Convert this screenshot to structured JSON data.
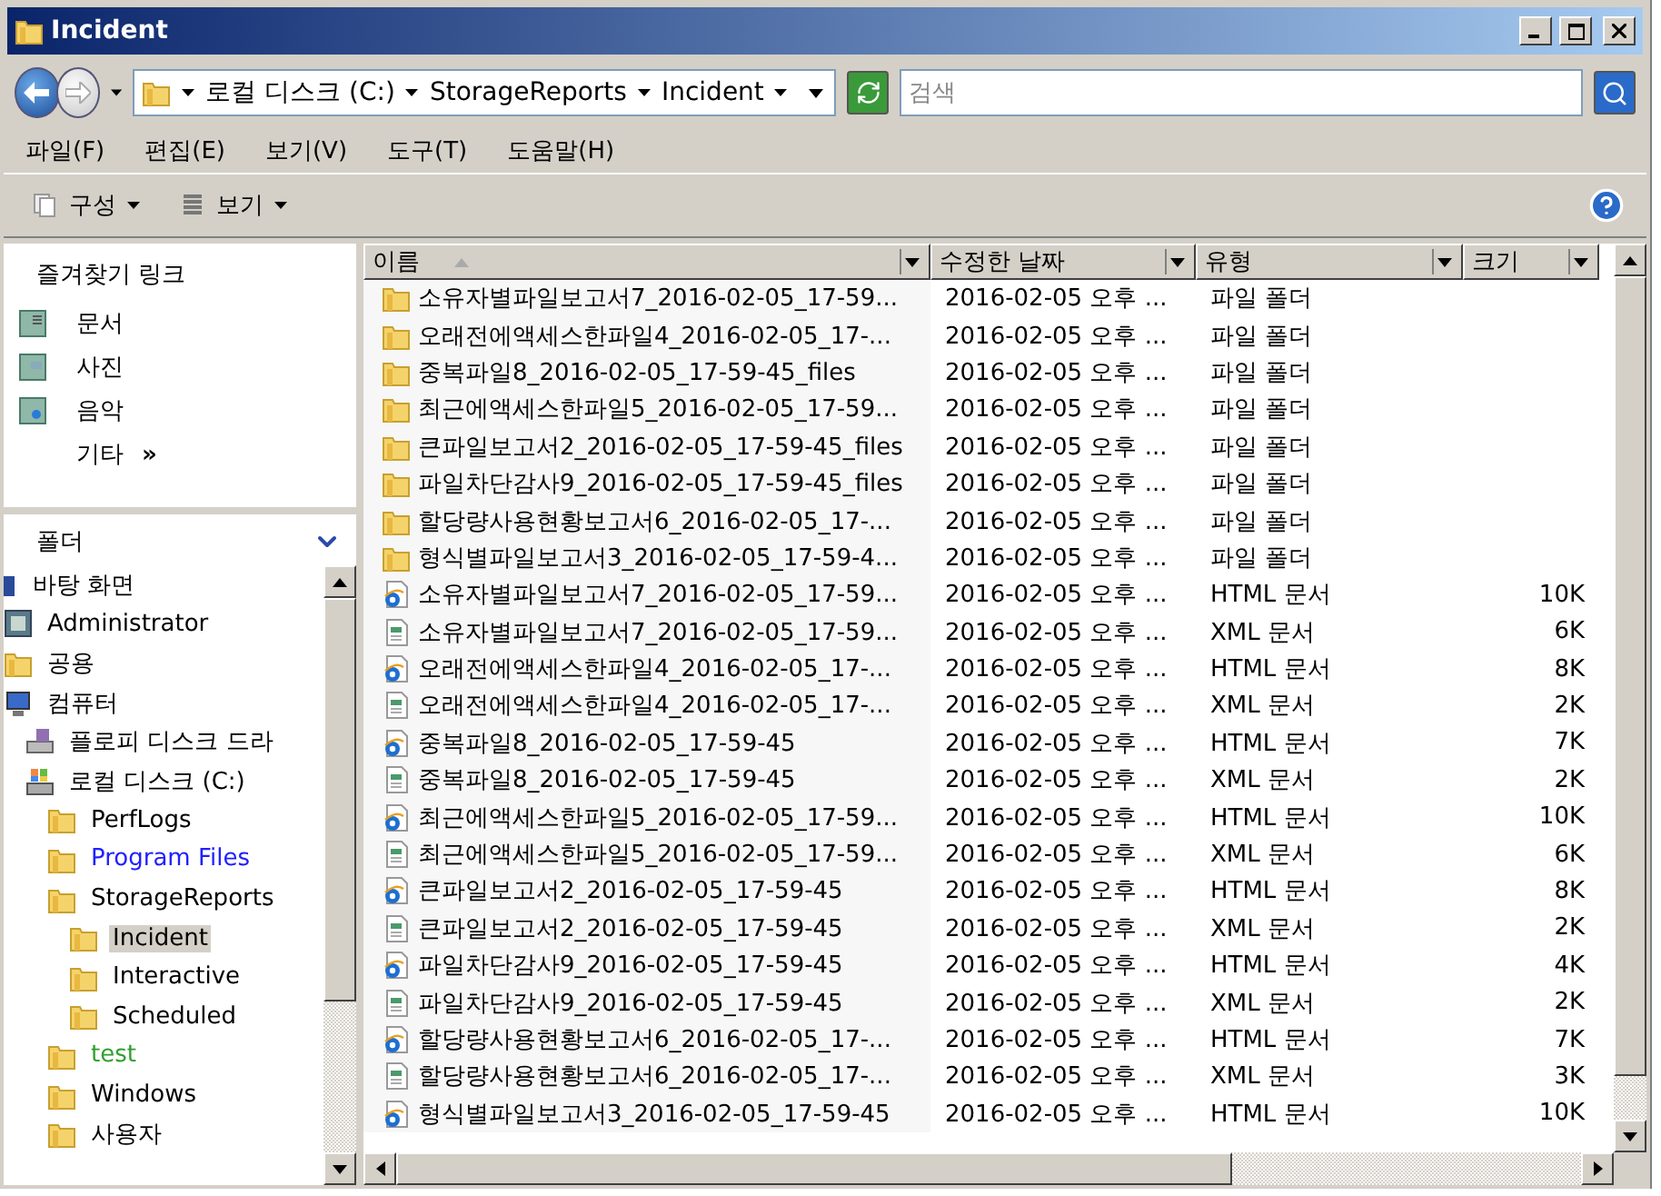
{
  "window": {
    "title": "Incident"
  },
  "address": {
    "crumbs": [
      "로컬 디스크 (C:)",
      "StorageReports",
      "Incident"
    ],
    "search_placeholder": "검색"
  },
  "menu": [
    "파일(F)",
    "편집(E)",
    "보기(V)",
    "도구(T)",
    "도움말(H)"
  ],
  "toolbar": [
    "구성",
    "보기"
  ],
  "favorites": {
    "title": "즐겨찾기 링크",
    "items": [
      {
        "label": "문서",
        "kind": "docs"
      },
      {
        "label": "사진",
        "kind": "pictures"
      },
      {
        "label": "음악",
        "kind": "music"
      },
      {
        "label": "기타",
        "kind": "more",
        "more": "»"
      }
    ]
  },
  "folders": {
    "title": "폴더",
    "tree": [
      {
        "label": "바탕 화면",
        "kind": "desktop",
        "selected": false
      },
      {
        "label": "Administrator",
        "kind": "user",
        "selected": false
      },
      {
        "label": "공용",
        "kind": "folder",
        "selected": false
      },
      {
        "label": "컴퓨터",
        "kind": "computer",
        "selected": false,
        "children": [
          {
            "label": "플로피 디스크 드라",
            "kind": "floppy",
            "selected": false
          },
          {
            "label": "로컬 디스크 (C:)",
            "kind": "disk",
            "selected": false,
            "children": [
              {
                "label": "PerfLogs",
                "kind": "folder",
                "selected": false
              },
              {
                "label": "Program Files",
                "kind": "folder",
                "selected": false,
                "color": "#2020ff"
              },
              {
                "label": "StorageReports",
                "kind": "folder",
                "selected": false,
                "children": [
                  {
                    "label": "Incident",
                    "kind": "folder",
                    "selected": true
                  },
                  {
                    "label": "Interactive",
                    "kind": "folder",
                    "selected": false
                  },
                  {
                    "label": "Scheduled",
                    "kind": "folder",
                    "selected": false
                  }
                ]
              },
              {
                "label": "test",
                "kind": "folder",
                "selected": false,
                "color": "#30a030"
              },
              {
                "label": "Windows",
                "kind": "folder",
                "selected": false
              },
              {
                "label": "사용자",
                "kind": "folder",
                "selected": false
              }
            ]
          }
        ]
      }
    ]
  },
  "table": {
    "columns": [
      {
        "label": "이름",
        "sorted": true
      },
      {
        "label": "수정한 날짜",
        "sorted": false
      },
      {
        "label": "유형",
        "sorted": false
      },
      {
        "label": "크기",
        "sorted": false
      }
    ],
    "rows": [
      {
        "kind": "folder",
        "name": "소유자별파일보고서7_2016-02-05_17-59...",
        "modified": "2016-02-05 오후 ...",
        "type": "파일 폴더"
      },
      {
        "kind": "folder",
        "name": "오래전에액세스한파일4_2016-02-05_17-...",
        "modified": "2016-02-05 오후 ...",
        "type": "파일 폴더"
      },
      {
        "kind": "folder",
        "name": "중복파일8_2016-02-05_17-59-45_files",
        "modified": "2016-02-05 오후 ...",
        "type": "파일 폴더"
      },
      {
        "kind": "folder",
        "name": "최근에액세스한파일5_2016-02-05_17-59...",
        "modified": "2016-02-05 오후 ...",
        "type": "파일 폴더"
      },
      {
        "kind": "folder",
        "name": "큰파일보고서2_2016-02-05_17-59-45_files",
        "modified": "2016-02-05 오후 ...",
        "type": "파일 폴더"
      },
      {
        "kind": "folder",
        "name": "파일차단감사9_2016-02-05_17-59-45_files",
        "modified": "2016-02-05 오후 ...",
        "type": "파일 폴더"
      },
      {
        "kind": "folder",
        "name": "할당량사용현황보고서6_2016-02-05_17-...",
        "modified": "2016-02-05 오후 ...",
        "type": "파일 폴더"
      },
      {
        "kind": "folder",
        "name": "형식별파일보고서3_2016-02-05_17-59-4...",
        "modified": "2016-02-05 오후 ...",
        "type": "파일 폴더"
      },
      {
        "kind": "html",
        "name": "소유자별파일보고서7_2016-02-05_17-59...",
        "modified": "2016-02-05 오후 ...",
        "type": "HTML 문서",
        "size": "10K"
      },
      {
        "kind": "xml",
        "name": "소유자별파일보고서7_2016-02-05_17-59...",
        "modified": "2016-02-05 오후 ...",
        "type": "XML 문서",
        "size": "6K"
      },
      {
        "kind": "html",
        "name": "오래전에액세스한파일4_2016-02-05_17-...",
        "modified": "2016-02-05 오후 ...",
        "type": "HTML 문서",
        "size": "8K"
      },
      {
        "kind": "xml",
        "name": "오래전에액세스한파일4_2016-02-05_17-...",
        "modified": "2016-02-05 오후 ...",
        "type": "XML 문서",
        "size": "2K"
      },
      {
        "kind": "html",
        "name": "중복파일8_2016-02-05_17-59-45",
        "modified": "2016-02-05 오후 ...",
        "type": "HTML 문서",
        "size": "7K"
      },
      {
        "kind": "xml",
        "name": "중복파일8_2016-02-05_17-59-45",
        "modified": "2016-02-05 오후 ...",
        "type": "XML 문서",
        "size": "2K"
      },
      {
        "kind": "html",
        "name": "최근에액세스한파일5_2016-02-05_17-59...",
        "modified": "2016-02-05 오후 ...",
        "type": "HTML 문서",
        "size": "10K"
      },
      {
        "kind": "xml",
        "name": "최근에액세스한파일5_2016-02-05_17-59...",
        "modified": "2016-02-05 오후 ...",
        "type": "XML 문서",
        "size": "6K"
      },
      {
        "kind": "html",
        "name": "큰파일보고서2_2016-02-05_17-59-45",
        "modified": "2016-02-05 오후 ...",
        "type": "HTML 문서",
        "size": "8K"
      },
      {
        "kind": "xml",
        "name": "큰파일보고서2_2016-02-05_17-59-45",
        "modified": "2016-02-05 오후 ...",
        "type": "XML 문서",
        "size": "2K"
      },
      {
        "kind": "html",
        "name": "파일차단감사9_2016-02-05_17-59-45",
        "modified": "2016-02-05 오후 ...",
        "type": "HTML 문서",
        "size": "4K"
      },
      {
        "kind": "xml",
        "name": "파일차단감사9_2016-02-05_17-59-45",
        "modified": "2016-02-05 오후 ...",
        "type": "XML 문서",
        "size": "2K"
      },
      {
        "kind": "html",
        "name": "할당량사용현황보고서6_2016-02-05_17-...",
        "modified": "2016-02-05 오후 ...",
        "type": "HTML 문서",
        "size": "7K"
      },
      {
        "kind": "xml",
        "name": "할당량사용현황보고서6_2016-02-05_17-...",
        "modified": "2016-02-05 오후 ...",
        "type": "XML 문서",
        "size": "3K"
      },
      {
        "kind": "html",
        "name": "형식별파일보고서3_2016-02-05_17-59-45",
        "modified": "2016-02-05 오후 ...",
        "type": "HTML 문서",
        "size": "10K"
      }
    ]
  }
}
